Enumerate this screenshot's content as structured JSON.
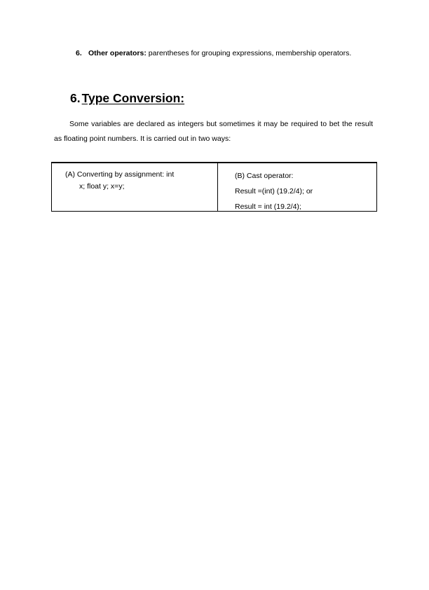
{
  "document": {
    "list_item": {
      "marker": "6.",
      "lead": "Other operators:",
      "text": " parentheses for grouping expressions, membership operators."
    },
    "heading": {
      "number": "6.",
      "title": "Type Conversion:"
    },
    "paragraph": "Some variables are declared as integers but sometimes it may be required to bet the result as floating point numbers. It is carried out in two ways:",
    "table": {
      "columns": [
        {
          "label": "(A)",
          "lines": [
            "(A) Converting by assignment: int",
            "x; float y; x=y;"
          ]
        },
        {
          "label": "(B)",
          "lines": [
            "(B) Cast operator:",
            "Result =(int) (19.2/4); or",
            "Result = int (19.2/4);"
          ]
        }
      ]
    }
  }
}
